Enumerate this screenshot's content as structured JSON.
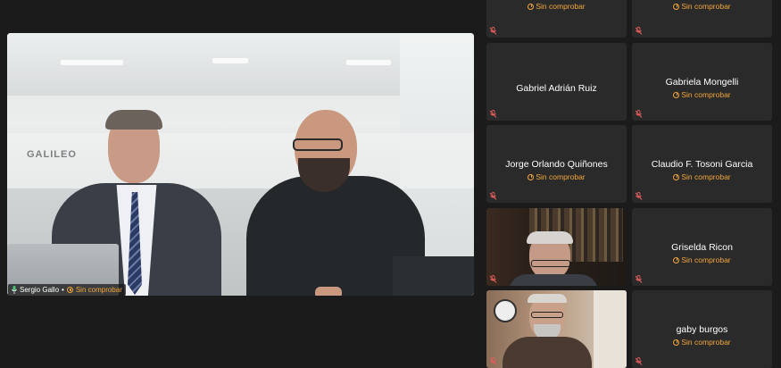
{
  "main_speaker": {
    "name": "Sergio Gallo",
    "separator": "•",
    "status": "Sin comprobar",
    "background_sign": "GALILEO"
  },
  "participants": [
    {
      "name": "",
      "status": "Sin comprobar",
      "muted": true,
      "has_video": false
    },
    {
      "name": "",
      "status": "Sin comprobar",
      "muted": true,
      "has_video": false
    },
    {
      "name": "Gabriel Adrián Ruiz",
      "status": "",
      "muted": true,
      "has_video": false
    },
    {
      "name": "Gabriela Mongelli",
      "status": "Sin comprobar",
      "muted": true,
      "has_video": false
    },
    {
      "name": "Jorge Orlando Quiñones",
      "status": "Sin comprobar",
      "muted": true,
      "has_video": false
    },
    {
      "name": "Claudio F. Tosoni Garcia",
      "status": "Sin comprobar",
      "muted": true,
      "has_video": false
    },
    {
      "name": "",
      "status": "",
      "muted": true,
      "has_video": true
    },
    {
      "name": "Griselda Ricon",
      "status": "Sin comprobar",
      "muted": true,
      "has_video": false
    },
    {
      "name": "",
      "status": "",
      "muted": true,
      "has_video": true
    },
    {
      "name": "gaby burgos",
      "status": "Sin comprobar",
      "muted": true,
      "has_video": false
    }
  ],
  "colors": {
    "background": "#1b1b1b",
    "tile": "#2a2a2a",
    "status": "#f3a63a",
    "mute": "#e05c5c"
  },
  "icons": {
    "status": "clock-icon",
    "muted": "mic-off-icon",
    "speaking": "mic-icon"
  }
}
